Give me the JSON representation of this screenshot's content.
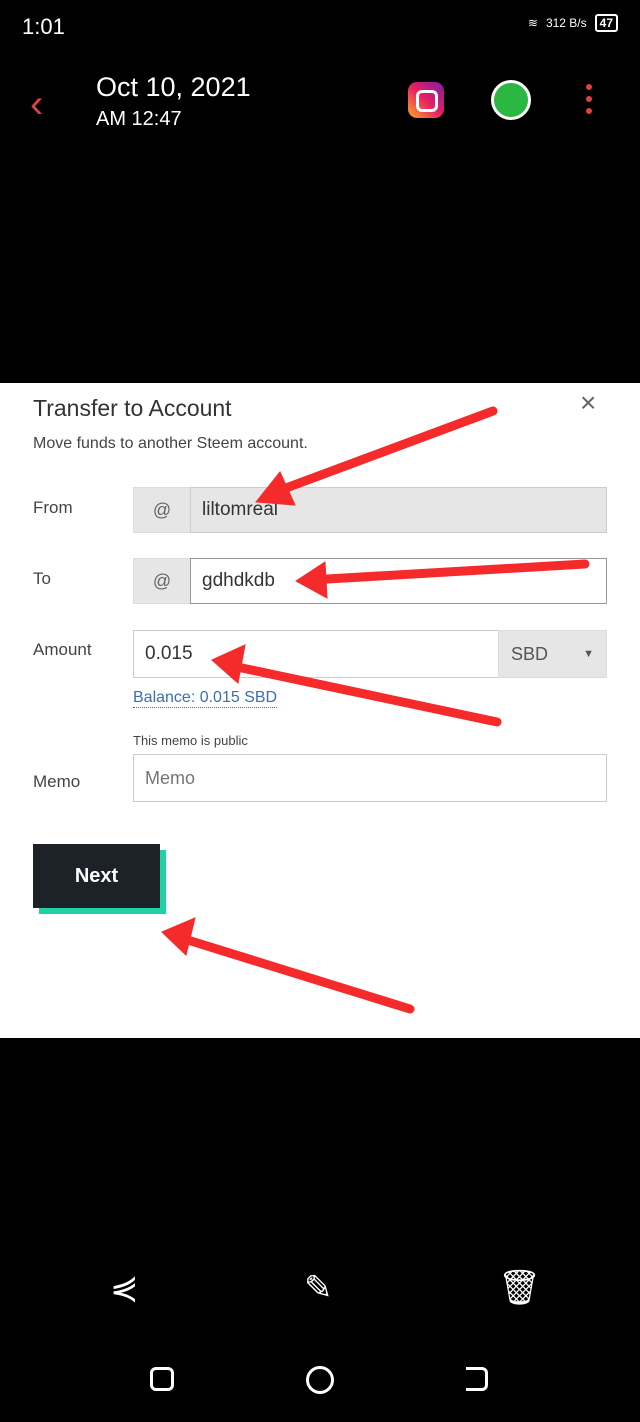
{
  "status": {
    "time": "1:01",
    "speed": "312 B/s",
    "battery": "47"
  },
  "header": {
    "date": "Oct 10, 2021",
    "time": "AM 12:47"
  },
  "modal": {
    "title": "Transfer to Account",
    "subtitle": "Move funds to another Steem account.",
    "close": "×",
    "from_label": "From",
    "from_prefix": "@",
    "from_value": "liltomreal",
    "to_label": "To",
    "to_prefix": "@",
    "to_value": "gdhdkdb",
    "amount_label": "Amount",
    "amount_value": "0.015",
    "currency": "SBD",
    "balance": "Balance: 0.015 SBD",
    "memo_note": "This memo is public",
    "memo_label": "Memo",
    "memo_placeholder": "Memo",
    "next": "Next"
  },
  "annotation_color": "#f52a2a"
}
